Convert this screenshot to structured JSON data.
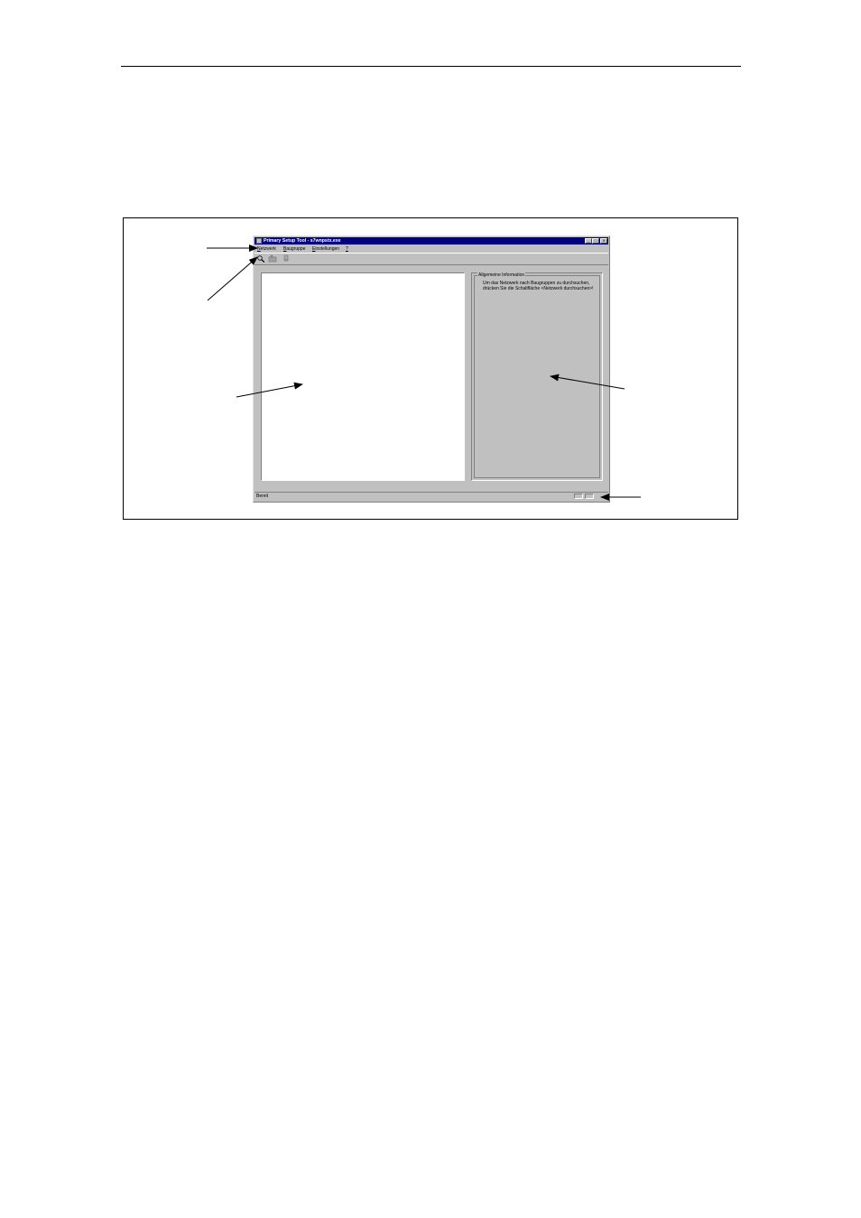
{
  "window": {
    "title": "Primary Setup Tool - s7wnpstx.exe",
    "controls": {
      "minimize": "_",
      "maximize": "□",
      "close": "✕"
    }
  },
  "menubar": {
    "items": [
      {
        "underline": "N",
        "rest": "etzwerk"
      },
      {
        "underline": "B",
        "rest": "augruppe"
      },
      {
        "underline": "E",
        "rest": "instellungen"
      },
      {
        "underline": "?",
        "rest": ""
      }
    ]
  },
  "toolbar": {
    "buttons": [
      "search-network-icon",
      "module-icon",
      "download-icon"
    ]
  },
  "info_panel": {
    "title": "Allgemeine Information",
    "lines": [
      "Um das Netzwerk nach Baugruppen zu durchsuchen,",
      "drücken Sie die Schaltfläche <Netzwerk durchsuchen>!"
    ]
  },
  "statusbar": {
    "text": "Bereit"
  },
  "colors": {
    "titlebar": "#000080",
    "window_face": "#c0c0c0",
    "tree_background": "#ffffff"
  }
}
